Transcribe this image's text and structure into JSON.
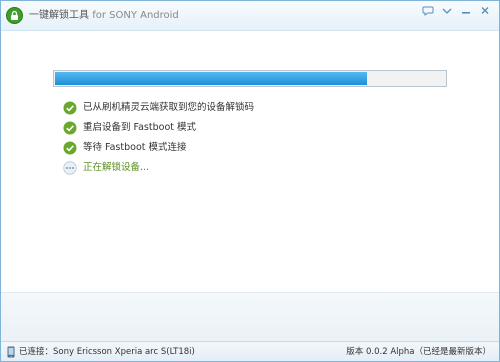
{
  "window": {
    "title_cn": "一键解锁工具",
    "title_en": "for SONY Android",
    "title_controls": [
      "feedback-icon",
      "menu-icon",
      "minimize-icon",
      "close-icon"
    ]
  },
  "progress": {
    "value": 0.8
  },
  "steps": [
    {
      "text": "已从刷机精灵云端获取到您的设备解锁码",
      "icon": "check-icon",
      "state": "done"
    },
    {
      "text": "重启设备到 Fastboot 模式",
      "icon": "check-icon",
      "state": "done"
    },
    {
      "text": "等待 Fastboot 模式连接",
      "icon": "check-icon",
      "state": "done"
    },
    {
      "text": "正在解锁设备...",
      "icon": "loading-icon",
      "state": "active"
    }
  ],
  "status": {
    "connected_text": "已连接：Sony Ericsson Xperia arc S(LT18i)",
    "version_text": "版本 0.0.2 Alpha（已经是最新版本）"
  },
  "colors": {
    "accent": "#1e8fd8",
    "success": "#6aa82b",
    "active_text": "#5a8f1e"
  }
}
